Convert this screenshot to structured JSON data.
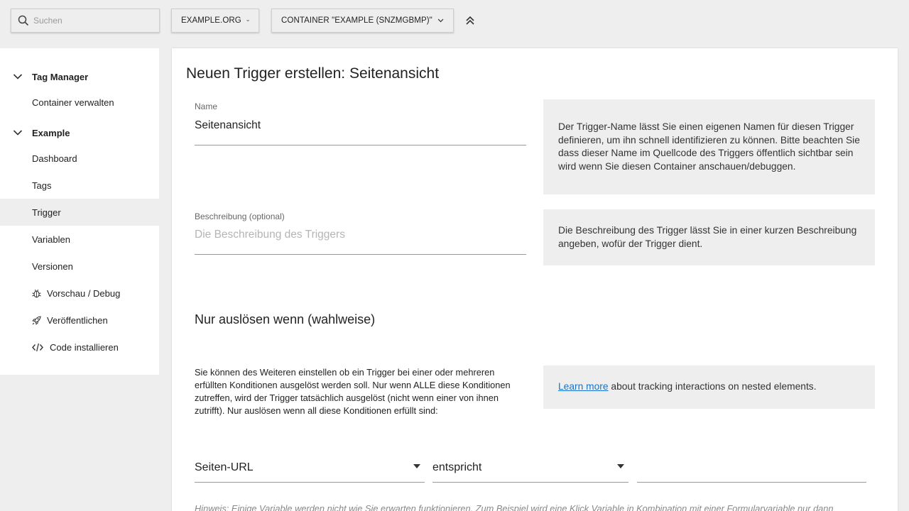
{
  "topbar": {
    "search_placeholder": "Suchen",
    "site_label": "EXAMPLE.ORG",
    "container_label": "CONTAINER \"EXAMPLE (SNZMGBMP)\""
  },
  "sidebar": {
    "tag_manager": "Tag Manager",
    "container_verwalten": "Container verwalten",
    "example": "Example",
    "items": [
      {
        "label": "Dashboard"
      },
      {
        "label": "Tags"
      },
      {
        "label": "Trigger"
      },
      {
        "label": "Variablen"
      },
      {
        "label": "Versionen"
      },
      {
        "label": "Vorschau / Debug",
        "icon": "bug-icon"
      },
      {
        "label": "Veröffentlichen",
        "icon": "rocket-icon"
      },
      {
        "label": "Code installieren",
        "icon": "code-icon"
      }
    ],
    "active": "Trigger"
  },
  "main": {
    "title": "Neuen Trigger erstellen: Seitenansicht",
    "name_label": "Name",
    "name_value": "Seitenansicht",
    "name_help": "Der Trigger-Name lässt Sie einen eigenen Namen für diesen Trigger definieren, um ihn schnell identifizieren zu können. Bitte beachten Sie dass dieser Name im Quellcode des Triggers öffentlich sichtbar sein wird wenn Sie diesen Container anschauen/debuggen.",
    "desc_label": "Beschreibung (optional)",
    "desc_placeholder": "Die Beschreibung des Triggers",
    "desc_help": "Die Beschreibung des Trigger lässt Sie in einer kurzen Beschreibung angeben, wofür der Trigger dient.",
    "section_title": "Nur auslösen wenn (wahlweise)",
    "section_text": "Sie können des Weiteren einstellen ob ein Trigger bei einer oder mehreren erfüllten Konditionen ausgelöst werden soll. Nur wenn ALLE diese Konditionen zutreffen, wird der Trigger tatsächlich ausgelöst (nicht wenn einer von ihnen zutrifft). Nur auslösen wenn all diese Konditionen erfüllt sind:",
    "learn_more": "Learn more",
    "learn_more_rest": " about tracking interactions on nested elements.",
    "condition_variable": "Seiten-URL",
    "condition_operator": "entspricht",
    "condition_value": "",
    "hint": "Hinweis: Einige Variable werden nicht wie Sie erwarten funktionieren. Zum Beispiel wird eine Klick Variable in Kombination mit einer Formularvariable nur dann"
  },
  "colors": {
    "background": "#eeeeee",
    "link": "#1a73c9",
    "active_item": "#eeeeee"
  }
}
